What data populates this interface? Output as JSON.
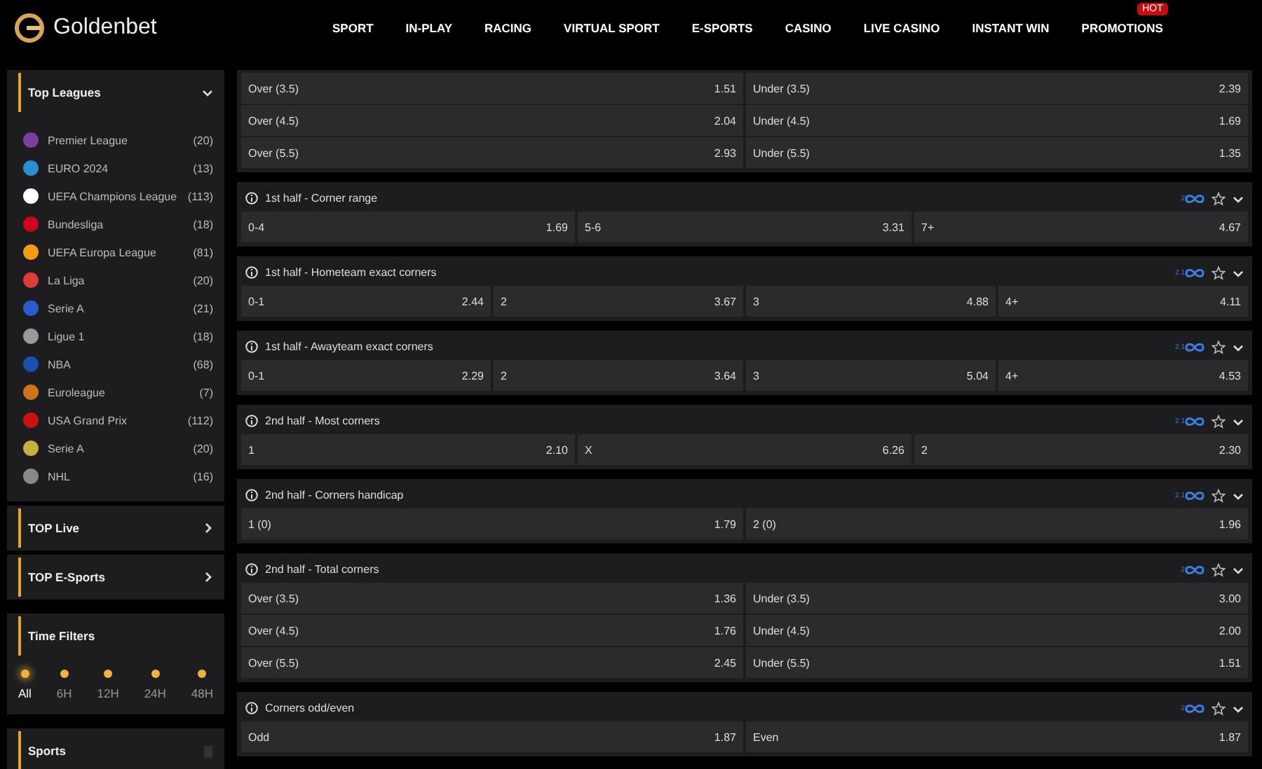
{
  "header": {
    "brand": "Goldenbet",
    "nav": [
      {
        "label": "SPORT"
      },
      {
        "label": "IN-PLAY"
      },
      {
        "label": "RACING"
      },
      {
        "label": "VIRTUAL SPORT"
      },
      {
        "label": "E-SPORTS"
      },
      {
        "label": "CASINO"
      },
      {
        "label": "LIVE CASINO"
      },
      {
        "label": "INSTANT WIN"
      },
      {
        "badge": "HOT",
        "label": "PROMOTIONS"
      }
    ]
  },
  "sidebar": {
    "top_leagues": {
      "title": "Top Leagues",
      "expanded": true,
      "items": [
        {
          "name": "Premier League",
          "count": "(20)"
        },
        {
          "name": "EURO 2024",
          "count": "(13)"
        },
        {
          "name": "UEFA Champions League",
          "count": "(113)"
        },
        {
          "name": "Bundesliga",
          "count": "(18)"
        },
        {
          "name": "UEFA Europa League",
          "count": "(81)"
        },
        {
          "name": "La Liga",
          "count": "(20)"
        },
        {
          "name": "Serie A",
          "count": "(21)"
        },
        {
          "name": "Ligue 1",
          "count": "(18)"
        },
        {
          "name": "NBA",
          "count": "(68)"
        },
        {
          "name": "Euroleague",
          "count": "(7)"
        },
        {
          "name": "USA Grand Prix",
          "count": "(112)"
        },
        {
          "name": "Serie A",
          "count": "(20)"
        },
        {
          "name": "NHL",
          "count": "(16)"
        }
      ]
    },
    "links": [
      {
        "title": "TOP Live"
      },
      {
        "title": "TOP E-Sports"
      }
    ],
    "time_filters": {
      "title": "Time Filters",
      "items": [
        {
          "label": "All",
          "selected": true
        },
        {
          "label": "6H",
          "selected": false
        },
        {
          "label": "12H",
          "selected": false
        },
        {
          "label": "24H",
          "selected": false
        },
        {
          "label": "48H",
          "selected": false
        }
      ]
    },
    "sports": {
      "title": "Sports"
    }
  },
  "markets": [
    {
      "rows": [
        [
          {
            "label": "Over (3.5)",
            "odds": "1.51"
          },
          {
            "label": "Under (3.5)",
            "odds": "2.39"
          }
        ],
        [
          {
            "label": "Over (4.5)",
            "odds": "2.04"
          },
          {
            "label": "Under (4.5)",
            "odds": "1.69"
          }
        ],
        [
          {
            "label": "Over (5.5)",
            "odds": "2.93"
          },
          {
            "label": "Under (5.5)",
            "odds": "1.35"
          }
        ]
      ]
    },
    {
      "title": "1st half - Corner range",
      "tag": "2",
      "rows": [
        [
          {
            "label": "0-4",
            "odds": "1.69"
          },
          {
            "label": "5-6",
            "odds": "3.31"
          },
          {
            "label": "7+",
            "odds": "4.67"
          }
        ]
      ]
    },
    {
      "title": "1st half - Hometeam exact corners",
      "tag": "2.1",
      "rows": [
        [
          {
            "label": "0-1",
            "odds": "2.44"
          },
          {
            "label": "2",
            "odds": "3.67"
          },
          {
            "label": "3",
            "odds": "4.88"
          },
          {
            "label": "4+",
            "odds": "4.11"
          }
        ]
      ]
    },
    {
      "title": "1st half - Awayteam exact corners",
      "tag": "2.1",
      "rows": [
        [
          {
            "label": "0-1",
            "odds": "2.29"
          },
          {
            "label": "2",
            "odds": "3.64"
          },
          {
            "label": "3",
            "odds": "5.04"
          },
          {
            "label": "4+",
            "odds": "4.53"
          }
        ]
      ]
    },
    {
      "title": "2nd half - Most corners",
      "tag": "2.1",
      "rows": [
        [
          {
            "label": "1",
            "odds": "2.10"
          },
          {
            "label": "X",
            "odds": "6.26"
          },
          {
            "label": "2",
            "odds": "2.30"
          }
        ]
      ]
    },
    {
      "title": "2nd half - Corners handicap",
      "tag": "2.1",
      "rows": [
        [
          {
            "label": "1 (0)",
            "odds": "1.79"
          },
          {
            "label": "2 (0)",
            "odds": "1.96"
          }
        ]
      ]
    },
    {
      "title": "2nd half - Total corners",
      "tag": "2",
      "rows": [
        [
          {
            "label": "Over (3.5)",
            "odds": "1.36"
          },
          {
            "label": "Under (3.5)",
            "odds": "3.00"
          }
        ],
        [
          {
            "label": "Over (4.5)",
            "odds": "1.76"
          },
          {
            "label": "Under (4.5)",
            "odds": "2.00"
          }
        ],
        [
          {
            "label": "Over (5.5)",
            "odds": "2.45"
          },
          {
            "label": "Under (5.5)",
            "odds": "1.51"
          }
        ]
      ]
    },
    {
      "title": "Corners odd/even",
      "tag": "2",
      "rows": [
        [
          {
            "label": "Odd",
            "odds": "1.87"
          },
          {
            "label": "Even",
            "odds": "1.87"
          }
        ]
      ]
    }
  ]
}
